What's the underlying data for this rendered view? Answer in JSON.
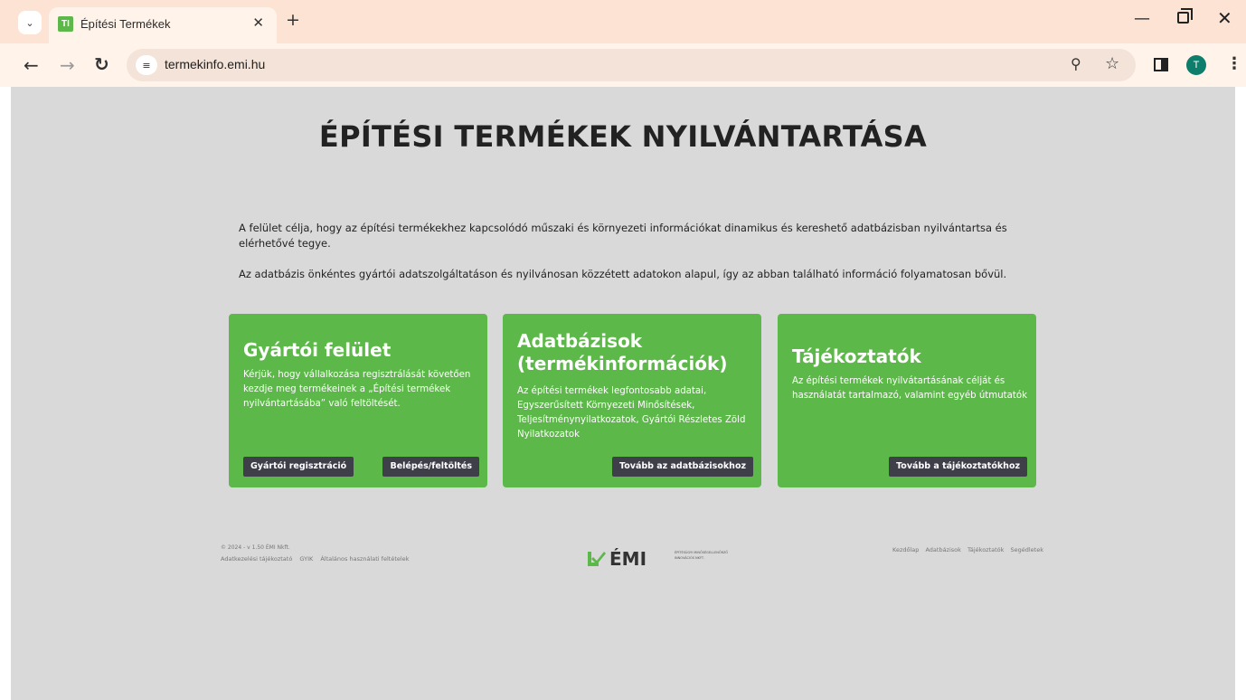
{
  "browser": {
    "tab_title": "Építési Termékek",
    "tab_favicon": "TI",
    "url": "termekinfo.emi.hu",
    "avatar_letter": "T",
    "icons": [
      "tab-list-icon",
      "close-icon",
      "plus-icon",
      "minimize-icon",
      "restore-icon",
      "window-close-icon",
      "back-icon",
      "forward-icon",
      "reload-icon",
      "site-info-icon",
      "zoom-icon",
      "star-icon",
      "side-panel-icon",
      "menu-icon"
    ]
  },
  "page": {
    "title": "ÉPÍTÉSI TERMÉKEK NYILVÁNTARTÁSA",
    "intro_1": "A felület célja, hogy az építési termékekhez kapcsolódó műszaki és környezeti információkat dinamikus és kereshető adatbázisban nyilvántartsa és elérhetővé tegye.",
    "intro_2": "Az adatbázis önkéntes gyártói adatszolgáltatáson és nyilvánosan közzétett adatokon alapul, így az abban található információ folyamatosan bővül.",
    "accent_color": "#5cb848",
    "button_color": "#3f3f4a",
    "cards": [
      {
        "title": "Gyártói felület",
        "text": "Kérjük, hogy vállalkozása regisztrálását követően kezdje meg termékeinek a „Építési termékek nyilvántartásába” való feltöltését.",
        "buttons": [
          "Gyártói regisztráció",
          "Belépés/feltöltés"
        ]
      },
      {
        "title": "Adatbázisok (termékinformációk)",
        "text": "Az építési termékek legfontosabb adatai, Egyszerűsített Környezeti Minősítések, Teljesítménynyilatkozatok, Gyártói Részletes Zöld Nyilatkozatok",
        "buttons": [
          "Tovább az adatbázisokhoz"
        ]
      },
      {
        "title": "Tájékoztatók",
        "text": "Az építési termékek nyilvátartásának célját és használatát tartalmazó, valamint egyéb útmutatók",
        "buttons": [
          "Tovább a tájékoztatókhoz"
        ]
      }
    ]
  },
  "footer": {
    "copyright": "© 2024 - v 1.50 ÉMI Nkft.",
    "links_left": [
      "Adatkezelési tájékoztató",
      "GYIK",
      "Általános használati feltételek"
    ],
    "logo_text": "ÉMI",
    "logo_subtext": "ÉPÍTÉSÜGYI MINŐSÉGELLENŐRZŐ INNOVÁCIÓS NKFT.",
    "links_right": [
      "Kezdőlap",
      "Adatbázisok",
      "Tájékoztatók",
      "Segédletek"
    ]
  }
}
